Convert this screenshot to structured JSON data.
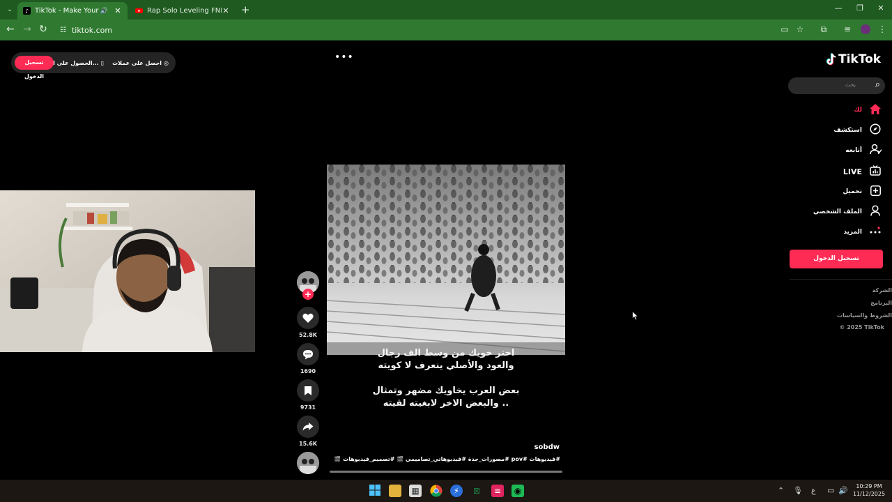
{
  "browser": {
    "tabs": [
      {
        "title": "TikTok - Make Your Day",
        "active": true
      },
      {
        "title": "Rap Solo Leveling FNR | ايشليق",
        "active": false
      }
    ],
    "url": "tiktok.com"
  },
  "top_bar": {
    "login_label": "تسجيل الدخول",
    "get_app_label": "الحصول على الت...",
    "get_coins_label": "احصل على عملات",
    "more_icon": "more-horizontal-icon"
  },
  "sidebar": {
    "logo_text": "TikTok",
    "search_placeholder": "بحث",
    "nav": [
      {
        "label": "لك",
        "icon": "home-icon",
        "active": true
      },
      {
        "label": "استكشف",
        "icon": "compass-icon"
      },
      {
        "label": "أتابعه",
        "icon": "following-icon"
      },
      {
        "label": "LIVE",
        "icon": "live-icon"
      },
      {
        "label": "تحميل",
        "icon": "upload-icon"
      },
      {
        "label": "الملف الشخصي",
        "icon": "profile-icon"
      },
      {
        "label": "المزيد",
        "icon": "more-icon"
      }
    ],
    "login_button": "تسجيل الدخول",
    "footer": [
      "الشركة",
      "البرنامج",
      "الشروط والسياسات",
      "© 2025 TikTok"
    ]
  },
  "video": {
    "caption_lines": [
      "اختر خويك من وسط الف رجال",
      "والعود والأصلي ينعرف لا كويته",
      "",
      "بعض العرب يخاويك مضهر وتمثال",
      "والبعض الاخر لابغيته لقيته .."
    ],
    "author": "sobdw",
    "tags": "#فيديوهات #pov #مصورات_جدة #فيديوهاتي_تصاميمي 🎬 #تصميم_فيديوهات 🎬 #ا 🎬",
    "likes": "52.8K",
    "comments": "1690",
    "saves": "9731",
    "shares": "15.6K"
  },
  "taskbar": {
    "time": "10:29 PM",
    "date": "11/12/2025",
    "lang": "ع"
  }
}
